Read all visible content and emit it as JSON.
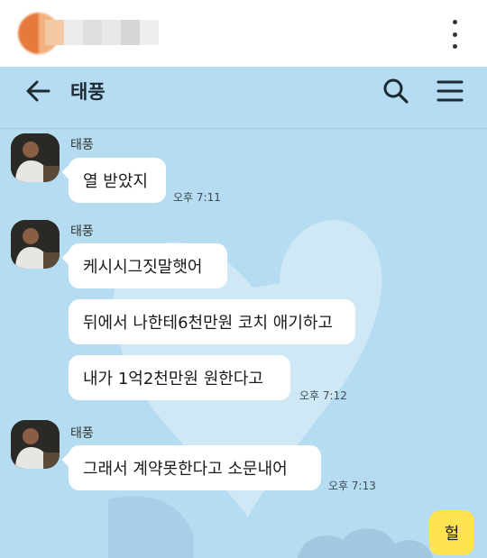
{
  "chat": {
    "title": "태풍",
    "messages": [
      {
        "sender": "태풍",
        "text": "열 받았지",
        "time": "오후 7:11"
      },
      {
        "sender": "태풍",
        "text": "케시시그짓말햇어"
      },
      {
        "text": "뒤에서 나한테6천만원 코치 애기하고"
      },
      {
        "text": "내가 1억2천만원 원한다고",
        "time": "오후 7:12"
      },
      {
        "sender": "태풍",
        "text": "그래서 계약못한다고 소문내어",
        "time": "오후 7:13"
      }
    ],
    "my_message": {
      "text": "헐"
    }
  },
  "icons": {
    "back": "arrow-left-icon",
    "search": "search-icon",
    "menu": "hamburger-menu-icon",
    "more": "kebab-menu-icon"
  },
  "colors": {
    "chat_background": "#b6dcf1",
    "incoming_bubble": "#ffffff",
    "outgoing_bubble": "#fce34f",
    "heart": "#cfe8f6"
  }
}
